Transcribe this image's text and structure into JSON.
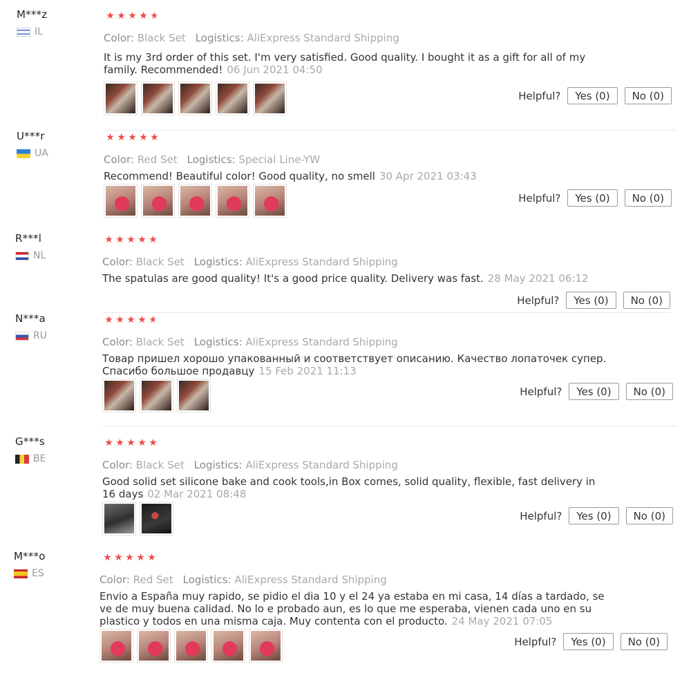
{
  "labels": {
    "color": "Color:",
    "logistics": "Logistics:",
    "helpful": "Helpful?",
    "yes": "Yes (0)",
    "no": "No (0)"
  },
  "reviews": [
    {
      "user": "M***z",
      "country": "IL",
      "stars": 4.5,
      "color": "Black Set",
      "logistics": "AliExpress Standard Shipping",
      "text_lines": [
        "It is my 3rd order of this set. I'm very satisfied. Good quality. I bought it as a gift for all of my",
        "family. Recommended!"
      ],
      "date": "06 Jun 2021 04:50",
      "photos": [
        "dark",
        "dark",
        "dark",
        "dark",
        "dark"
      ]
    },
    {
      "user": "U***r",
      "country": "UA",
      "stars": 5,
      "color": "Red Set",
      "logistics": "Special Line-YW",
      "text_lines": [
        "Recommend! Beautiful color! Good quality, no smell"
      ],
      "date": "30 Apr 2021 03:43",
      "photos": [
        "red",
        "red",
        "red",
        "red",
        "red"
      ]
    },
    {
      "user": "R***l",
      "country": "NL",
      "stars": 5,
      "color": "Black Set",
      "logistics": "AliExpress Standard Shipping",
      "text_lines": [
        "The spatulas are good quality! It's a good price quality. Delivery was fast."
      ],
      "date": "28 May 2021 06:12",
      "photos": []
    },
    {
      "user": "N***a",
      "country": "RU",
      "stars": 4.5,
      "color": "Black Set",
      "logistics": "AliExpress Standard Shipping",
      "text_lines": [
        "Товар пришел хорошо упакованный и соответствует описанию. Качество лопаточек супер.",
        "Спасибо большое продавцу"
      ],
      "date": "15 Feb 2021 11:13",
      "photos": [
        "dark",
        "dark",
        "dark"
      ]
    },
    {
      "user": "G***s",
      "country": "BE",
      "stars": 5,
      "color": "Black Set",
      "logistics": "AliExpress Standard Shipping",
      "text_lines": [
        "Good solid set silicone bake and cook tools,in Box comes, solid quality, flexible, fast delivery in",
        "16 days"
      ],
      "date": "02 Mar 2021 08:48",
      "photos": [
        "gray",
        "black"
      ]
    },
    {
      "user": "M***o",
      "country": "ES",
      "stars": 5,
      "color": "Red Set",
      "logistics": "AliExpress Standard Shipping",
      "text_lines": [
        "Envio a España muy rapido, se pidio el dia 10 y el 24 ya estaba en mi casa, 14 días a tardado, se",
        "ve de muy buena calidad. No lo e probado aun, es lo que me esperaba, vienen cada uno en su",
        "plastico y todos en una misma caja. Muy contenta con el producto."
      ],
      "date": "24 May 2021 07:05",
      "photos": [
        "red",
        "red",
        "red",
        "red",
        "red"
      ]
    }
  ],
  "colors": {
    "star": "#f04b4b",
    "divider": "#e6e6e6",
    "muted": "#a9a9a9"
  }
}
